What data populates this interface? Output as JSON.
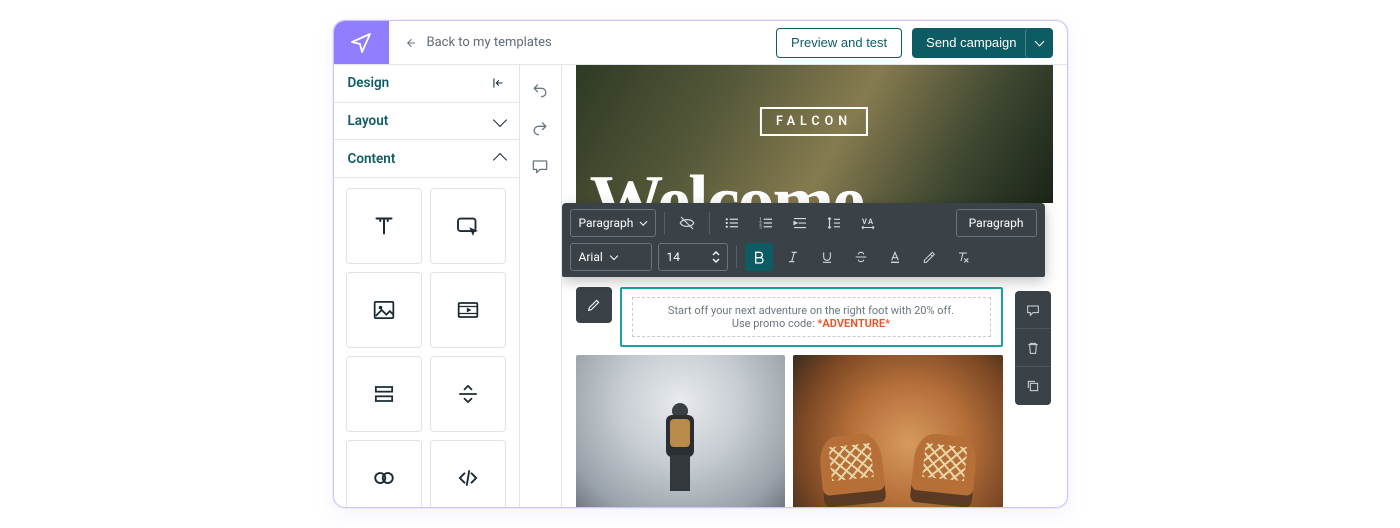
{
  "header": {
    "back_label": "Back to my templates",
    "preview_label": "Preview and test",
    "send_label": "Send campaign"
  },
  "sidebar": {
    "panels": {
      "design": "Design",
      "layout": "Layout",
      "content": "Content"
    },
    "blocks": [
      {
        "name": "text-block"
      },
      {
        "name": "button-block"
      },
      {
        "name": "image-block"
      },
      {
        "name": "video-block"
      },
      {
        "name": "spacer-block"
      },
      {
        "name": "divider-block"
      },
      {
        "name": "social-block"
      },
      {
        "name": "html-block"
      }
    ]
  },
  "canvas": {
    "brand": "FALCON",
    "hero_title": "Welcome",
    "text_block": {
      "line1": "Start off your next adventure on the right foot with 20% off.",
      "promo_label": "Use promo code: ",
      "promo_code": "*ADVENTURE*"
    }
  },
  "toolbar": {
    "style_select": "Paragraph",
    "paragraph_btn": "Paragraph",
    "font_select": "Arial",
    "font_size": "14"
  },
  "colors": {
    "accent": "#0e5c63",
    "brand_purple": "#8f7fff",
    "promo": "#e25b2f"
  }
}
